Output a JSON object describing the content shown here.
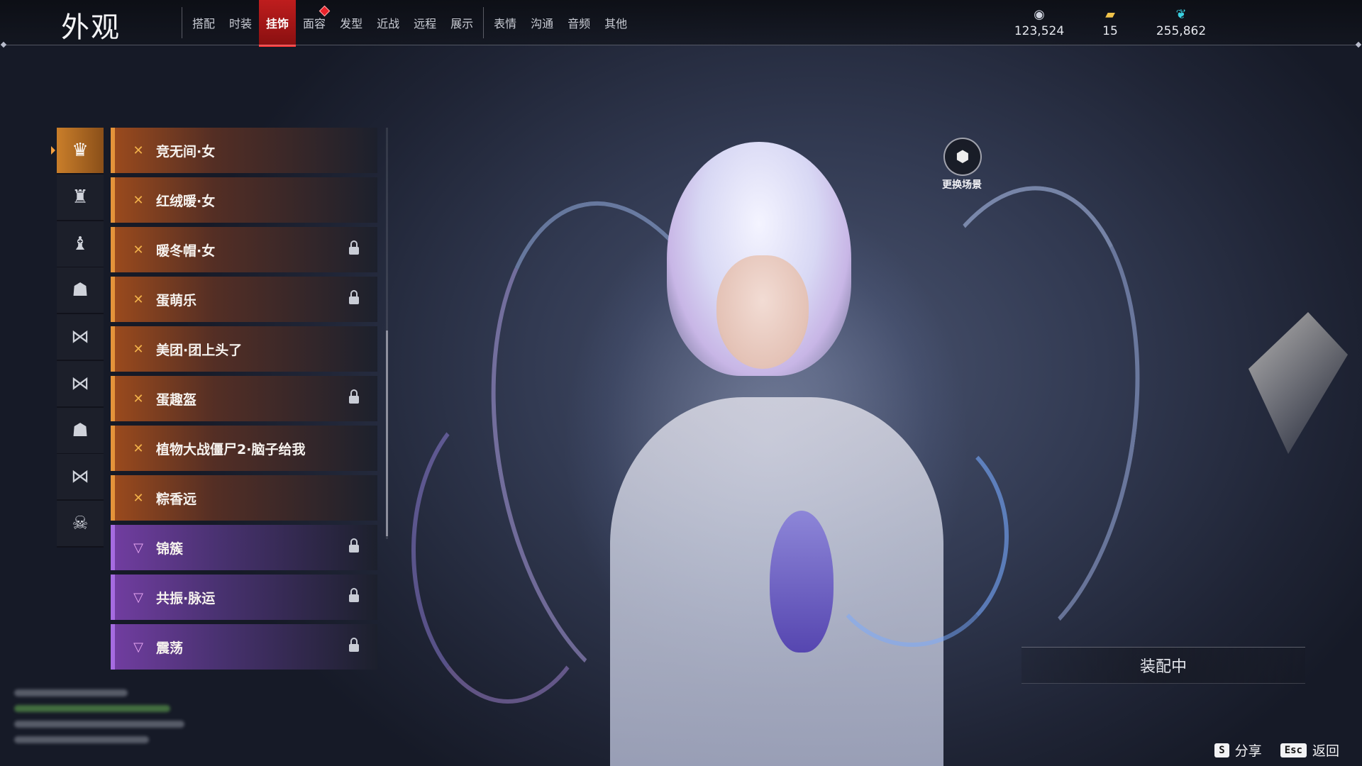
{
  "page_title": "外观",
  "tabs": [
    {
      "label": "搭配",
      "active": false
    },
    {
      "label": "时装",
      "active": false
    },
    {
      "label": "挂饰",
      "active": true
    },
    {
      "label": "面容",
      "active": false,
      "badge": true
    },
    {
      "label": "发型",
      "active": false
    },
    {
      "label": "近战",
      "active": false
    },
    {
      "label": "远程",
      "active": false
    },
    {
      "label": "展示",
      "active": false
    },
    {
      "label": "表情",
      "active": false
    },
    {
      "label": "沟通",
      "active": false
    },
    {
      "label": "音频",
      "active": false
    },
    {
      "label": "其他",
      "active": false
    }
  ],
  "currencies": [
    {
      "icon": "coin-icon",
      "value": "123,524",
      "color": "#cfd3de"
    },
    {
      "icon": "ticket-icon",
      "value": "15",
      "color": "#f0c24a"
    },
    {
      "icon": "feather-icon",
      "value": "255,862",
      "color": "#39d0e0"
    }
  ],
  "categories": [
    {
      "icon": "mask-icon",
      "glyph": "♛",
      "active": true
    },
    {
      "icon": "head-icon",
      "glyph": "♜",
      "active": false
    },
    {
      "icon": "back-icon",
      "glyph": "♝",
      "active": false
    },
    {
      "icon": "waist-icon",
      "glyph": "☗",
      "active": false
    },
    {
      "icon": "bow-icon",
      "glyph": "⋈",
      "active": false
    },
    {
      "icon": "bow-alt-icon",
      "glyph": "⋈",
      "active": false
    },
    {
      "icon": "hat-icon",
      "glyph": "☗",
      "active": false
    },
    {
      "icon": "wing-icon",
      "glyph": "⋈",
      "active": false
    },
    {
      "icon": "demon-mask-icon",
      "glyph": "☠",
      "active": false
    }
  ],
  "items": [
    {
      "label": "竞无间·女",
      "rarity": "orange",
      "locked": false
    },
    {
      "label": "红绒暖·女",
      "rarity": "orange",
      "locked": false
    },
    {
      "label": "暖冬帽·女",
      "rarity": "orange",
      "locked": true
    },
    {
      "label": "蛋萌乐",
      "rarity": "orange",
      "locked": true
    },
    {
      "label": "美团·团上头了",
      "rarity": "orange",
      "locked": false
    },
    {
      "label": "蛋趣盔",
      "rarity": "orange",
      "locked": true
    },
    {
      "label": "植物大战僵尸2·脑子给我",
      "rarity": "orange",
      "locked": false
    },
    {
      "label": "粽香远",
      "rarity": "orange",
      "locked": false
    },
    {
      "label": "锦簇",
      "rarity": "purple",
      "locked": true
    },
    {
      "label": "共振·脉运",
      "rarity": "purple",
      "locked": true
    },
    {
      "label": "震荡",
      "rarity": "purple",
      "locked": true
    }
  ],
  "scene_button_label": "更换场景",
  "equipped_label": "装配中",
  "hints": [
    {
      "key": "S",
      "label": "分享"
    },
    {
      "key": "Esc",
      "label": "返回"
    }
  ]
}
